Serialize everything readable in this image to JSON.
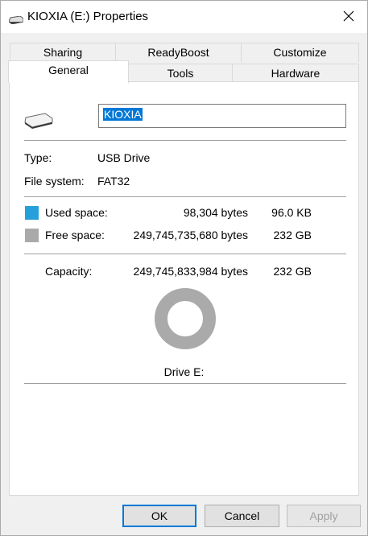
{
  "window": {
    "title": "KIOXIA (E:) Properties"
  },
  "tabs": {
    "row1": [
      "Sharing",
      "ReadyBoost",
      "Customize"
    ],
    "row2": [
      "General",
      "Tools",
      "Hardware"
    ],
    "active": "General"
  },
  "general": {
    "name_value": "KIOXIA",
    "type_label": "Type:",
    "type_value": "USB Drive",
    "fs_label": "File system:",
    "fs_value": "FAT32",
    "used_label": "Used space:",
    "used_bytes": "98,304 bytes",
    "used_size": "96.0 KB",
    "free_label": "Free space:",
    "free_bytes": "249,745,735,680 bytes",
    "free_size": "232 GB",
    "capacity_label": "Capacity:",
    "capacity_bytes": "249,745,833,984 bytes",
    "capacity_size": "232 GB",
    "drive_label": "Drive E:"
  },
  "buttons": {
    "ok": "OK",
    "cancel": "Cancel",
    "apply": "Apply"
  },
  "colors": {
    "used": "#26a0da",
    "free": "#aaaaaa",
    "accent": "#0078d7"
  },
  "icons": {
    "title": "usb-drive-icon",
    "drive": "usb-drive-icon",
    "close": "close-icon"
  },
  "chart_data": {
    "type": "pie",
    "categories": [
      "Used space",
      "Free space"
    ],
    "values": [
      98304,
      249745735680
    ]
  }
}
